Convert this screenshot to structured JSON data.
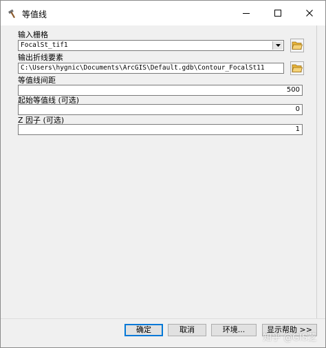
{
  "window": {
    "title": "等值线",
    "controls": {
      "minimize": "—",
      "maximize": "☐",
      "close": "✕"
    }
  },
  "form": {
    "input_raster": {
      "label": "输入栅格",
      "value": "FocalSt_tif1"
    },
    "output_features": {
      "label": "输出折线要素",
      "value": "C:\\Users\\hygnic\\Documents\\ArcGIS\\Default.gdb\\Contour_FocalSt11"
    },
    "contour_interval": {
      "label": "等值线间距",
      "value": "500"
    },
    "base_contour": {
      "label": "起始等值线 (可选)",
      "value": "0"
    },
    "z_factor": {
      "label": "Z 因子 (可选)",
      "value": "1"
    }
  },
  "buttons": {
    "ok": "确定",
    "cancel": "取消",
    "environments": "环境...",
    "show_help": "显示帮助 >>"
  },
  "watermark": "知乎 @GIS芝",
  "colors": {
    "accent": "#0078d7",
    "dialog_bg": "#f0f0f0",
    "folder": "#e8b53a"
  }
}
